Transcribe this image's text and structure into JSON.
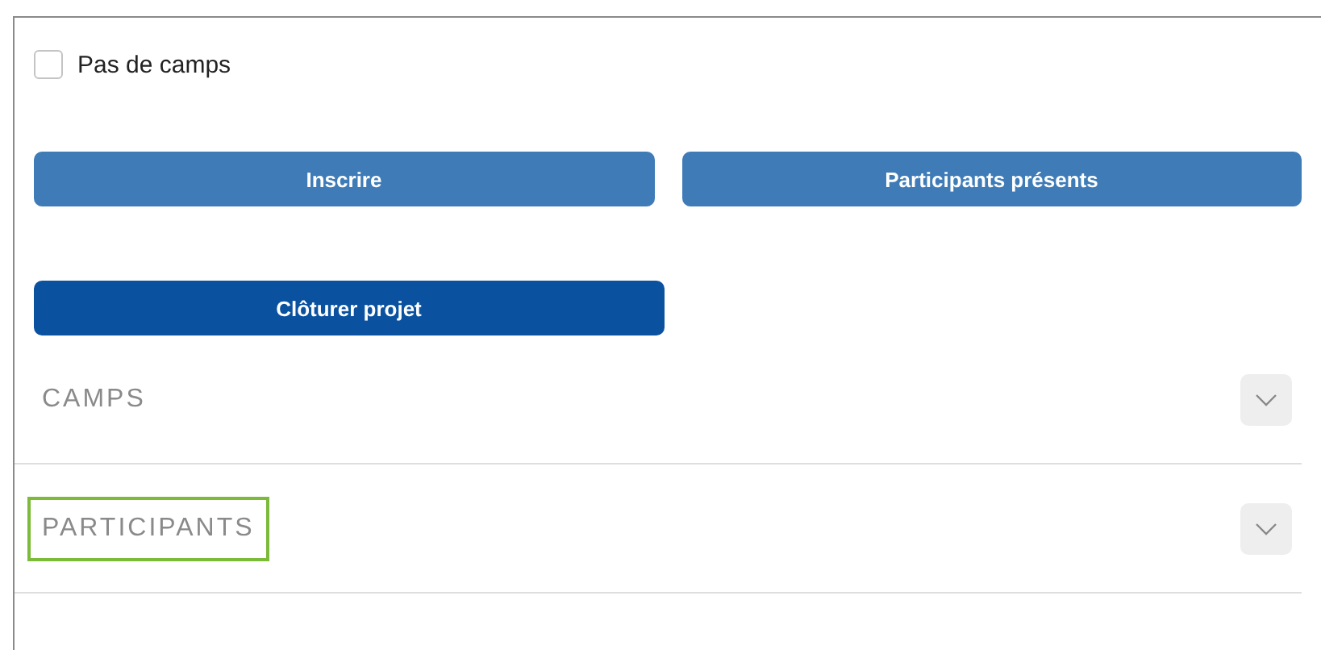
{
  "checkbox": {
    "label": "Pas de camps",
    "checked": false
  },
  "button_rows": [
    [
      {
        "label": "Inscrire",
        "kind": "light"
      },
      {
        "label": "Participants présents",
        "kind": "light"
      }
    ],
    [
      {
        "label": "Clôturer projet",
        "kind": "dark"
      }
    ]
  ],
  "sections": [
    {
      "title": "CAMPS",
      "highlighted": false,
      "expanded": false
    },
    {
      "title": "PARTICIPANTS",
      "highlighted": true,
      "expanded": false
    }
  ]
}
